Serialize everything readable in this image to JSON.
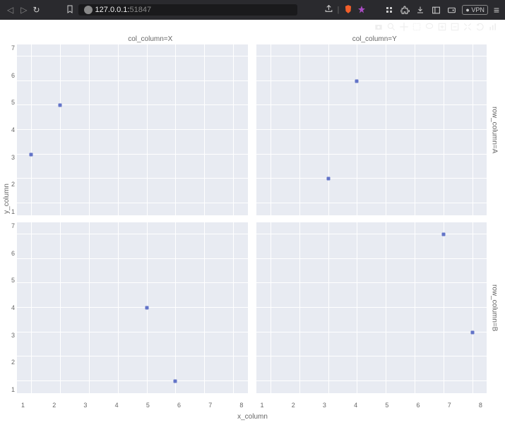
{
  "browser": {
    "address_host": "127.0.0.1:",
    "address_port": "51847",
    "vpn": "VPN"
  },
  "modebar_icons": [
    "camera-icon",
    "zoom-icon",
    "pan-icon",
    "select-icon",
    "lasso-icon",
    "zoomin-icon",
    "zoomout-icon",
    "autoscale-icon",
    "reset-icon",
    "logo-icon"
  ],
  "chart_data": {
    "type": "scatter",
    "facet_col_var": "col_column",
    "facet_row_var": "row_column",
    "col_labels": [
      "col_column=X",
      "col_column=Y"
    ],
    "row_labels": [
      "row_column=A",
      "row_column=B"
    ],
    "xlabel": "x_column",
    "ylabel": "y_column",
    "xlim": [
      0.5,
      8.5
    ],
    "ylim": [
      0.5,
      7.5
    ],
    "x_ticks": [
      1,
      2,
      3,
      4,
      5,
      6,
      7,
      8
    ],
    "y_ticks": [
      1,
      2,
      3,
      4,
      5,
      6,
      7
    ],
    "panels": [
      {
        "row": "A",
        "col": "X",
        "points": [
          {
            "x": 1,
            "y": 3
          },
          {
            "x": 2,
            "y": 5
          }
        ]
      },
      {
        "row": "A",
        "col": "Y",
        "points": [
          {
            "x": 3,
            "y": 2
          },
          {
            "x": 4,
            "y": 6
          }
        ]
      },
      {
        "row": "B",
        "col": "X",
        "points": [
          {
            "x": 5,
            "y": 4
          },
          {
            "x": 6,
            "y": 1
          }
        ]
      },
      {
        "row": "B",
        "col": "Y",
        "points": [
          {
            "x": 7,
            "y": 7
          },
          {
            "x": 8,
            "y": 3
          }
        ]
      }
    ],
    "marker_color": "#6374c8"
  }
}
